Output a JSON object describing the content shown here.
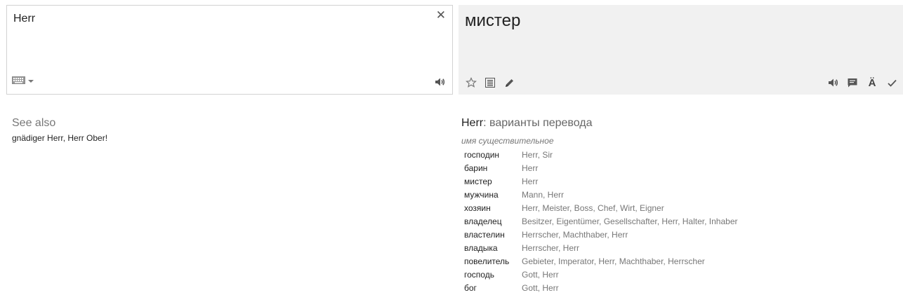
{
  "source": {
    "text": "Herr",
    "clear_glyph": "✕"
  },
  "target": {
    "text": "мистер"
  },
  "see_also": {
    "title": "See also",
    "links": "gnädiger Herr, Herr Ober!"
  },
  "variants": {
    "word": "Herr",
    "header_rest": ": варианты перевода",
    "part_of_speech": "имя существительное",
    "rows": [
      {
        "term": "господин",
        "synonyms": "Herr, Sir"
      },
      {
        "term": "барин",
        "synonyms": "Herr"
      },
      {
        "term": "мистер",
        "synonyms": "Herr"
      },
      {
        "term": "мужчина",
        "synonyms": "Mann, Herr"
      },
      {
        "term": "хозяин",
        "synonyms": "Herr, Meister, Boss, Chef, Wirt, Eigner"
      },
      {
        "term": "владелец",
        "synonyms": "Besitzer, Eigentümer, Gesellschafter, Herr, Halter, Inhaber"
      },
      {
        "term": "властелин",
        "synonyms": "Herrscher, Machthaber, Herr"
      },
      {
        "term": "владыка",
        "synonyms": "Herrscher, Herr"
      },
      {
        "term": "повелитель",
        "synonyms": "Gebieter, Imperator, Herr, Machthaber, Herrscher"
      },
      {
        "term": "господь",
        "synonyms": "Gott, Herr"
      },
      {
        "term": "бог",
        "synonyms": "Gott, Herr"
      }
    ]
  },
  "icons": {
    "keyboard": "keyboard-icon",
    "speaker": "speaker-icon",
    "star": "star-icon",
    "list": "list-icon",
    "pencil": "pencil-icon",
    "feedback": "feedback-icon",
    "transliteration_glyph": "Ä",
    "check": "check-icon"
  }
}
